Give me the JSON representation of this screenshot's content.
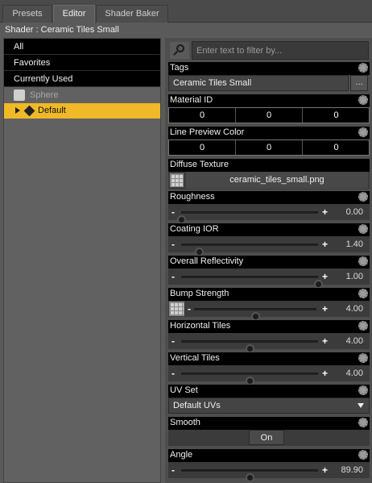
{
  "tabs": [
    {
      "label": "Presets"
    },
    {
      "label": "Editor"
    },
    {
      "label": "Shader Baker"
    }
  ],
  "shader_title": "Shader : Ceramic Tiles Small",
  "left_nav": {
    "items": [
      {
        "label": "All"
      },
      {
        "label": "Favorites"
      },
      {
        "label": "Currently Used"
      }
    ],
    "tree": {
      "object": "Sphere",
      "selected": "Default"
    }
  },
  "filter": {
    "placeholder": "Enter text to filter by..."
  },
  "properties": {
    "tags": {
      "label": "Tags",
      "value": "Ceramic Tiles Small",
      "button": "..."
    },
    "material_id": {
      "label": "Material ID",
      "values": [
        "0",
        "0",
        "0"
      ]
    },
    "line_preview_color": {
      "label": "Line Preview Color",
      "values": [
        "0",
        "0",
        "0"
      ]
    },
    "diffuse_texture": {
      "label": "Diffuse Texture",
      "file": "ceramic_tiles_small.png"
    },
    "roughness": {
      "label": "Roughness",
      "value": "0.00",
      "fraction": 0.0
    },
    "coating_ior": {
      "label": "Coating IOR",
      "value": "1.40",
      "fraction": 0.13
    },
    "overall_reflectivity": {
      "label": "Overall Reflectivity",
      "value": "1.00",
      "fraction": 1.0
    },
    "bump_strength": {
      "label": "Bump Strength",
      "value": "4.00",
      "fraction": 0.5
    },
    "horizontal_tiles": {
      "label": "Horizontal Tiles",
      "value": "4.00",
      "fraction": 0.5
    },
    "vertical_tiles": {
      "label": "Vertical Tiles",
      "value": "4.00",
      "fraction": 0.5
    },
    "uv_set": {
      "label": "UV Set",
      "value": "Default UVs"
    },
    "smooth": {
      "label": "Smooth",
      "value": "On"
    },
    "angle": {
      "label": "Angle",
      "value": "89.90",
      "fraction": 0.5
    }
  }
}
